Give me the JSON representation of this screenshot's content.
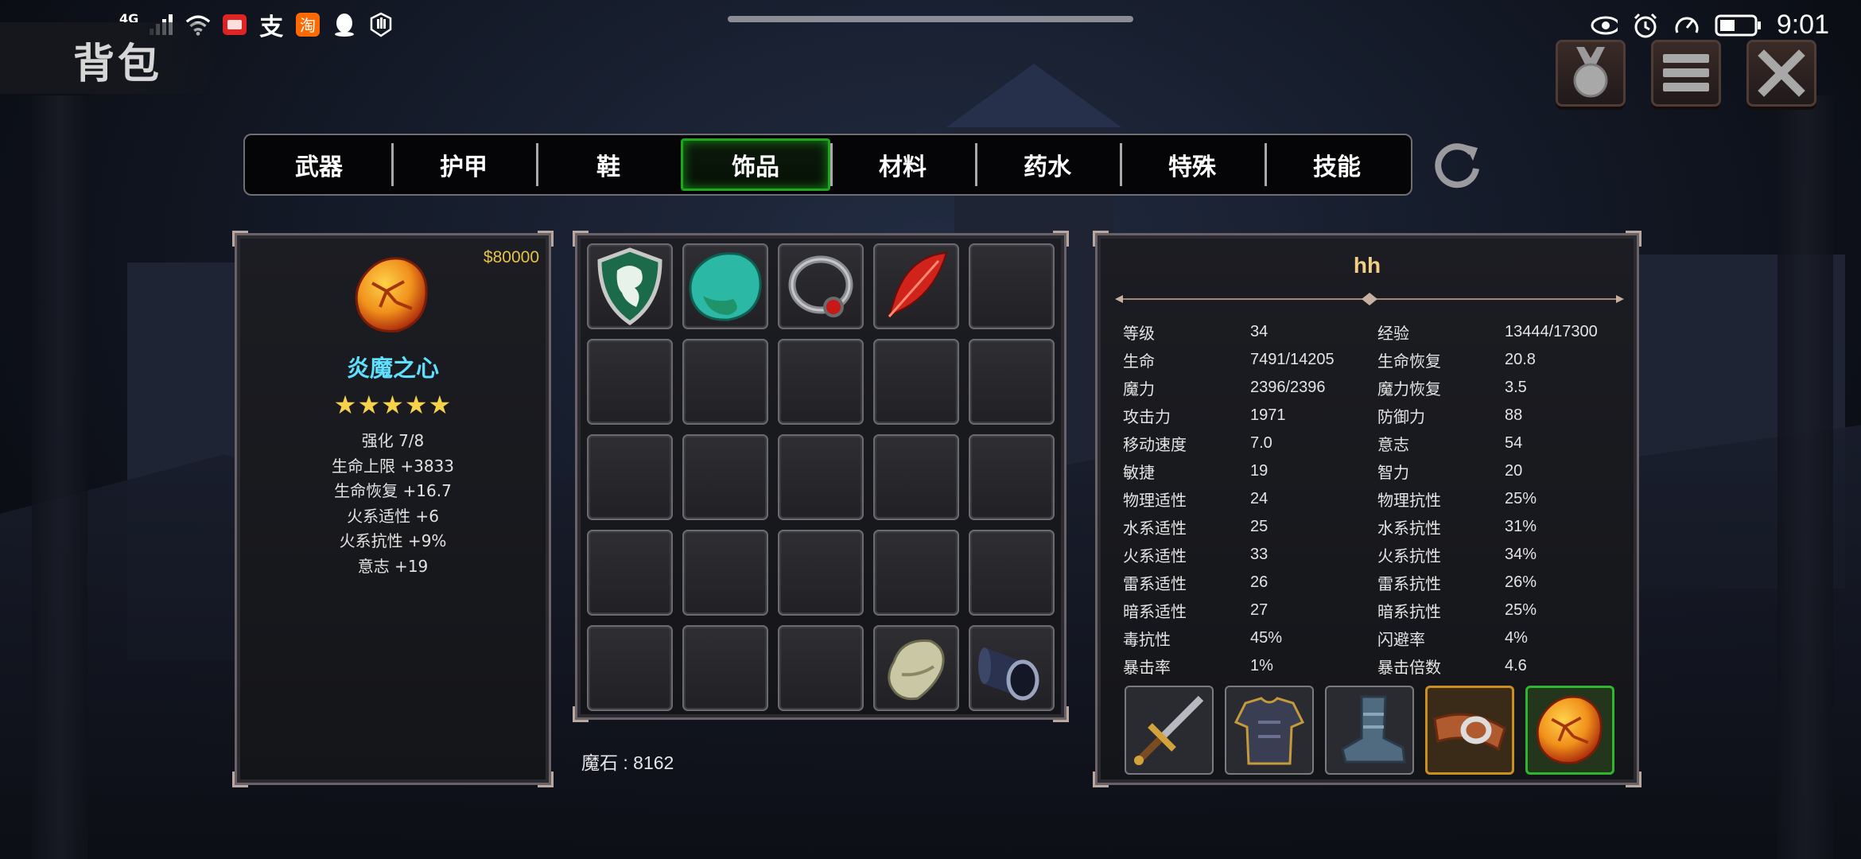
{
  "status_bar": {
    "network": "4G",
    "time": "9:01"
  },
  "title": "背包",
  "tabs": [
    {
      "label": "武器"
    },
    {
      "label": "护甲"
    },
    {
      "label": "鞋"
    },
    {
      "label": "饰品"
    },
    {
      "label": "材料"
    },
    {
      "label": "药水"
    },
    {
      "label": "特殊"
    },
    {
      "label": "技能"
    }
  ],
  "active_tab": "饰品",
  "selected_item": {
    "price": "$80000",
    "icon": "flame-demon-heart-icon",
    "name": "炎魔之心",
    "stars": "★★★★★",
    "star_count": 5,
    "attributes": [
      "强化 7/8",
      "生命上限  +3833",
      "生命恢复  +16.7",
      "火系适性  +6",
      "火系抗性  +9%",
      "意志  +19"
    ]
  },
  "inventory": {
    "slots": [
      "dragon-shield-amulet-icon",
      "jade-stone-icon",
      "ruby-ring-icon",
      "red-feather-icon",
      "",
      "",
      "",
      "",
      "",
      "",
      "",
      "",
      "",
      "",
      "",
      "",
      "",
      "",
      "",
      "",
      "",
      "",
      "",
      "bone-fragment-icon",
      "scroll-cylinder-icon"
    ],
    "magic_stone": "魔石 : 8162"
  },
  "character": {
    "name": "hh",
    "stats": [
      [
        "等级",
        "34",
        "经验",
        "13444/17300"
      ],
      [
        "生命",
        "7491/14205",
        "生命恢复",
        "20.8"
      ],
      [
        "魔力",
        "2396/2396",
        "魔力恢复",
        "3.5"
      ],
      [
        "攻击力",
        "1971",
        "防御力",
        "88"
      ],
      [
        "移动速度",
        "7.0",
        "意志",
        "54"
      ],
      [
        "敏捷",
        "19",
        "智力",
        "20"
      ],
      [
        "物理适性",
        "24",
        "物理抗性",
        "25%"
      ],
      [
        "水系适性",
        "25",
        "水系抗性",
        "31%"
      ],
      [
        "火系适性",
        "33",
        "火系抗性",
        "34%"
      ],
      [
        "雷系适性",
        "26",
        "雷系抗性",
        "26%"
      ],
      [
        "暗系适性",
        "27",
        "暗系抗性",
        "25%"
      ],
      [
        "毒抗性",
        "45%",
        "闪避率",
        "4%"
      ],
      [
        "暴击率",
        "1%",
        "暴击倍数",
        "4.6"
      ]
    ],
    "equipment": [
      {
        "icon": "sword-icon",
        "frame": "normal"
      },
      {
        "icon": "armor-icon",
        "frame": "normal"
      },
      {
        "icon": "boots-icon",
        "frame": "normal"
      },
      {
        "icon": "belt-accessory-icon",
        "frame": "gold"
      },
      {
        "icon": "flame-demon-heart-icon",
        "frame": "green"
      }
    ]
  },
  "colors": {
    "accent_green": "#1fa51f",
    "item_name": "#5fe0ff",
    "price": "#e6c24a",
    "char_name": "#f2cf86"
  }
}
